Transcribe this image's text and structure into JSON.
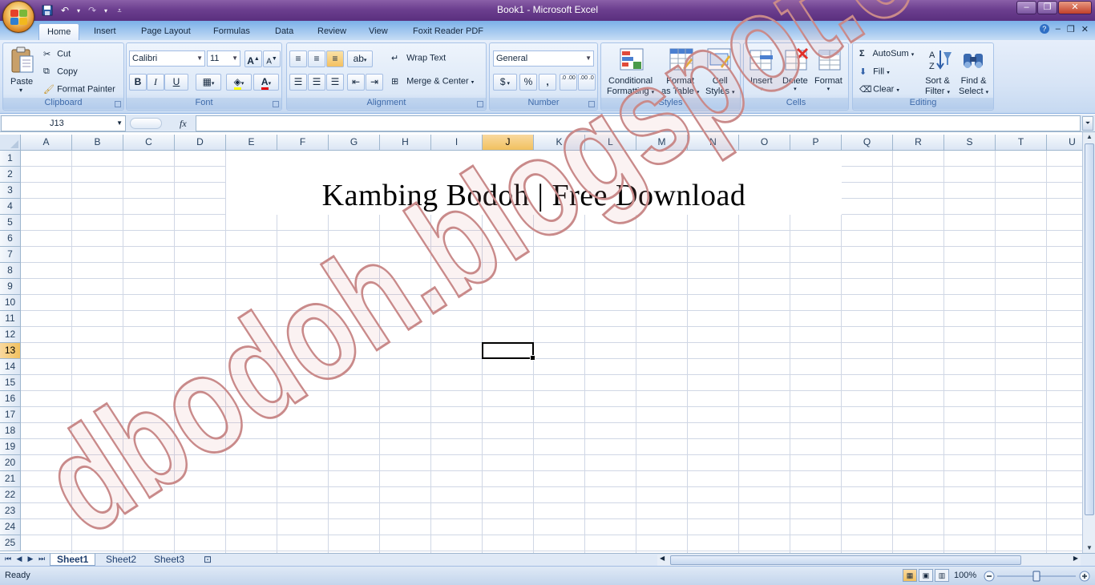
{
  "window": {
    "title": "Book1 - Microsoft Excel"
  },
  "tabs": [
    {
      "label": "Home"
    },
    {
      "label": "Insert"
    },
    {
      "label": "Page Layout"
    },
    {
      "label": "Formulas"
    },
    {
      "label": "Data"
    },
    {
      "label": "Review"
    },
    {
      "label": "View"
    },
    {
      "label": "Foxit Reader PDF"
    }
  ],
  "ribbon": {
    "clipboard": {
      "label": "Clipboard",
      "paste": "Paste",
      "cut": "Cut",
      "copy": "Copy",
      "format_painter": "Format Painter"
    },
    "font": {
      "label": "Font",
      "family": "Calibri",
      "size": "11",
      "bold": "B",
      "italic": "I",
      "underline": "U",
      "grow": "A",
      "shrink": "A"
    },
    "alignment": {
      "label": "Alignment",
      "wrap": "Wrap Text",
      "merge": "Merge & Center"
    },
    "number": {
      "label": "Number",
      "format": "General",
      "currency": "$",
      "percent": "%",
      "comma": ",",
      "inc_decimal": ".0 .00",
      "dec_decimal": ".00 .0"
    },
    "styles": {
      "label": "Styles",
      "conditional_1": "Conditional",
      "conditional_2": "Formatting",
      "table_1": "Format",
      "table_2": "as Table",
      "cell_1": "Cell",
      "cell_2": "Styles"
    },
    "cells": {
      "label": "Cells",
      "insert": "Insert",
      "delete": "Delete",
      "format": "Format"
    },
    "editing": {
      "label": "Editing",
      "autosum": "AutoSum",
      "fill": "Fill",
      "clear": "Clear",
      "sort_1": "Sort &",
      "sort_2": "Filter",
      "find_1": "Find &",
      "find_2": "Select"
    }
  },
  "formula_bar": {
    "name_box": "J13",
    "fx": "fx",
    "value": ""
  },
  "grid": {
    "columns": [
      "A",
      "B",
      "C",
      "D",
      "E",
      "F",
      "G",
      "H",
      "I",
      "J",
      "K",
      "L",
      "M",
      "N",
      "O",
      "P",
      "Q",
      "R",
      "S",
      "T",
      "U"
    ],
    "rows": [
      "1",
      "2",
      "3",
      "4",
      "5",
      "6",
      "7",
      "8",
      "9",
      "10",
      "11",
      "12",
      "13",
      "14",
      "15",
      "16",
      "17",
      "18",
      "19",
      "20",
      "21",
      "22",
      "23",
      "24",
      "25"
    ],
    "selected_column": "J",
    "selected_row": "13",
    "merged_text": "Kambing Bodoh | Free Download"
  },
  "watermark": {
    "text": "dbodoh.blogspot.com"
  },
  "sheets": [
    {
      "label": "Sheet1"
    },
    {
      "label": "Sheet2"
    },
    {
      "label": "Sheet3"
    }
  ],
  "status": {
    "ready": "Ready",
    "zoom": "100%"
  },
  "colors": {
    "accent": "#7bb0e8",
    "selection": "#f1c15f",
    "title_bar": "#6c3f8f",
    "watermark": "#c98a8a"
  }
}
